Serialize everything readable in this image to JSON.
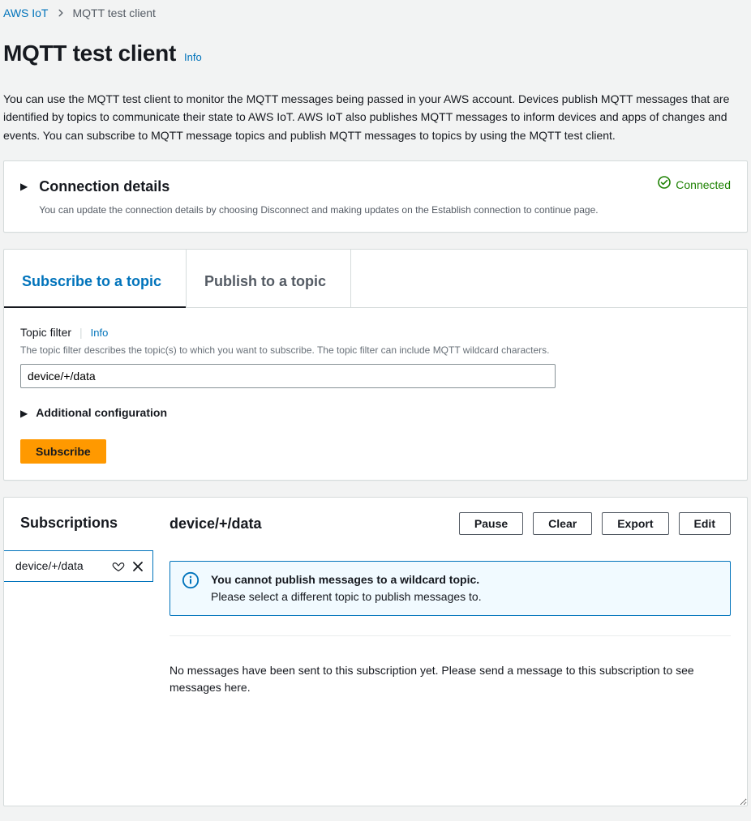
{
  "breadcrumb": {
    "root": "AWS IoT",
    "current": "MQTT test client"
  },
  "header": {
    "title": "MQTT test client",
    "info": "Info"
  },
  "intro": "You can use the MQTT test client to monitor the MQTT messages being passed in your AWS account. Devices publish MQTT messages that are identified by topics to communicate their state to AWS IoT. AWS IoT also publishes MQTT messages to inform devices and apps of changes and events. You can subscribe to MQTT message topics and publish MQTT messages to topics by using the MQTT test client.",
  "connection": {
    "title": "Connection details",
    "sub": "You can update the connection details by choosing Disconnect and making updates on the Establish connection to continue page.",
    "status": "Connected"
  },
  "tabs": {
    "subscribe": "Subscribe to a topic",
    "publish": "Publish to a topic"
  },
  "form": {
    "label": "Topic filter",
    "info": "Info",
    "help": "The topic filter describes the topic(s) to which you want to subscribe. The topic filter can include MQTT wildcard characters.",
    "value": "device/+/data",
    "additional": "Additional configuration",
    "subscribe": "Subscribe"
  },
  "subs": {
    "title": "Subscriptions",
    "items": [
      {
        "topic": "device/+/data"
      }
    ],
    "selected": "device/+/data",
    "buttons": {
      "pause": "Pause",
      "clear": "Clear",
      "export": "Export",
      "edit": "Edit"
    },
    "alert": {
      "title": "You cannot publish messages to a wildcard topic.",
      "body": "Please select a different topic to publish messages to."
    },
    "empty": "No messages have been sent to this subscription yet. Please send a message to this subscription to see messages here."
  }
}
